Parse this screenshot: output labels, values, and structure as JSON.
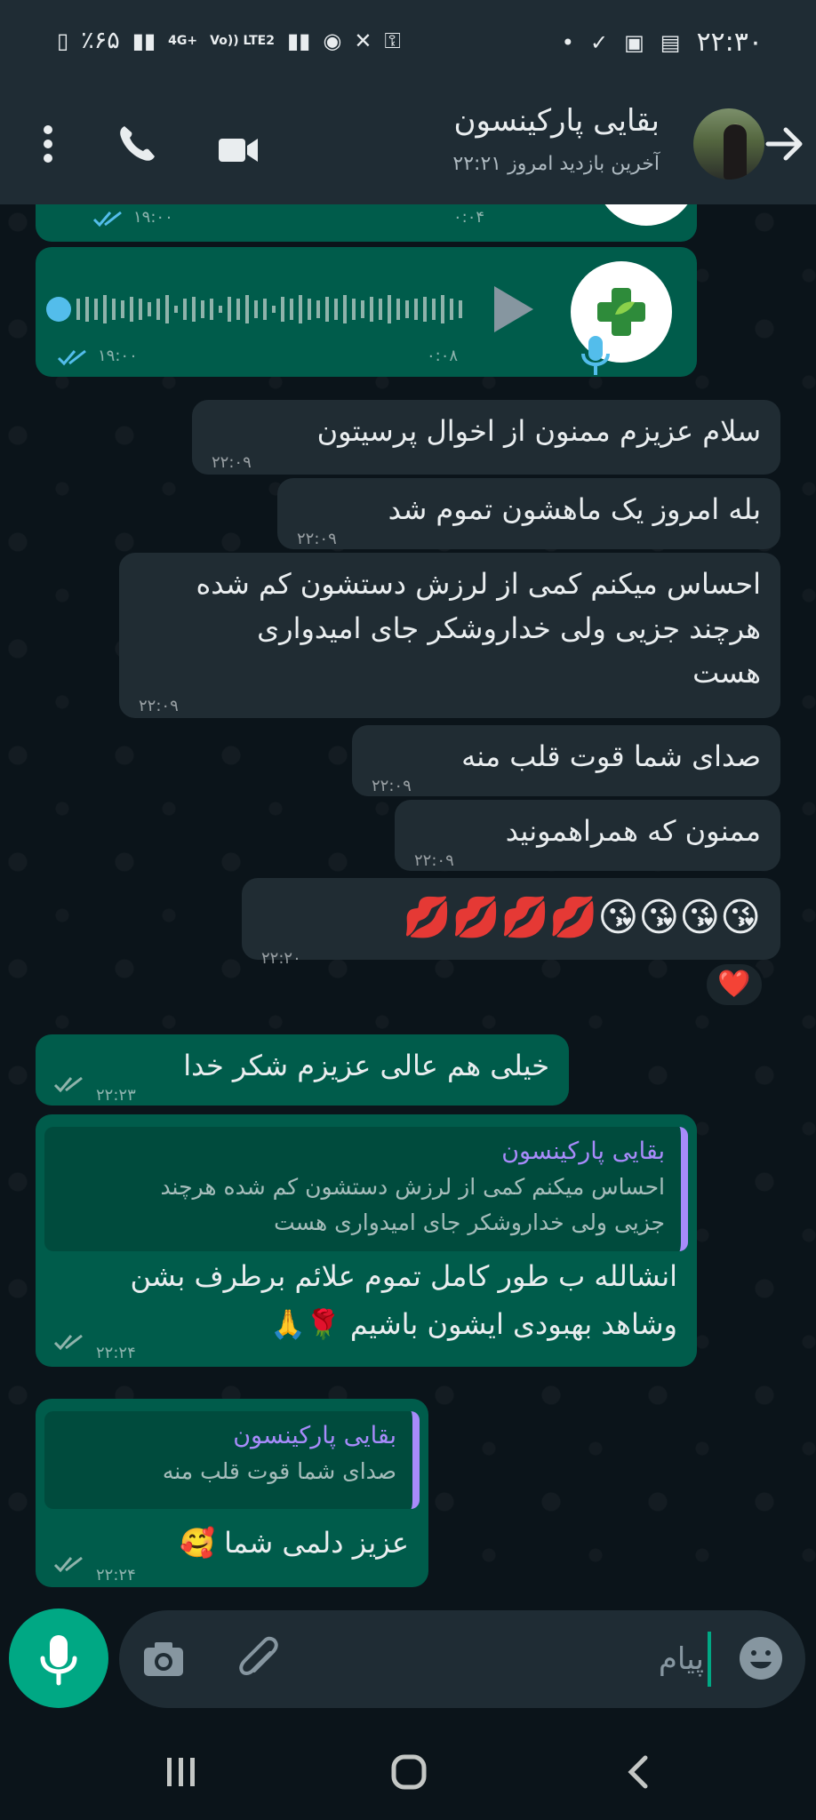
{
  "status_bar": {
    "time": "۲۲:۳۰",
    "battery": "٪۶۵",
    "net1": "4G+",
    "net2": "Vo)) LTE2"
  },
  "header": {
    "contact_name": "بقایی پارکینسون",
    "last_seen": "آخرین بازدید امروز ۲۲:۲۱"
  },
  "voice_messages": [
    {
      "duration": "۰:۰۴",
      "time": "۱۹:۰۰"
    },
    {
      "duration": "۰:۰۸",
      "time": "۱۹:۰۰"
    }
  ],
  "messages": [
    {
      "text": "سلام عزیزم ممنون از اخوال پرسیتون",
      "time": "۲۲:۰۹"
    },
    {
      "text": "بله امروز یک ماهشون تموم شد",
      "time": "۲۲:۰۹"
    },
    {
      "line1": "احساس میکنم کمی از لرزش دستشون کم شده",
      "line2": "هرچند جزیی ولی خداروشکر جای امیدواری",
      "line3": "هست",
      "time": "۲۲:۰۹"
    },
    {
      "text": "صدای شما قوت قلب منه",
      "time": "۲۲:۰۹"
    },
    {
      "text": "ممنون که همراهمونید",
      "time": "۲۲:۰۹"
    },
    {
      "text": "😘😘😘😘💋💋💋💋",
      "time": "۲۲:۲۰",
      "reaction": "❤️"
    }
  ],
  "outgoing": [
    {
      "text": "خیلی هم عالی عزیزم شکر خدا",
      "time": "۲۲:۲۳"
    },
    {
      "reply_name": "بقایی پارکینسون",
      "reply_line1": "احساس میکنم کمی از لرزش دستشون کم شده هرچند",
      "reply_line2": "جزیی ولی خداروشکر جای امیدواری هست",
      "line1": "انشالله ب طور کامل تموم علائم برطرف بشن",
      "line2": "وشاهد بهبودی ایشون باشیم 🌹🙏",
      "time": "۲۲:۲۴"
    },
    {
      "reply_name": "بقایی پارکینسون",
      "reply_text": "صدای شما قوت قلب منه",
      "text": "عزیز دلمی شما 🥰",
      "time": "۲۲:۲۴"
    }
  ],
  "input": {
    "placeholder": "پیام"
  },
  "colors": {
    "incoming": "#202c33",
    "outgoing": "#005c4b",
    "accent": "#00a884",
    "reply_bar": "#a78bfa"
  }
}
